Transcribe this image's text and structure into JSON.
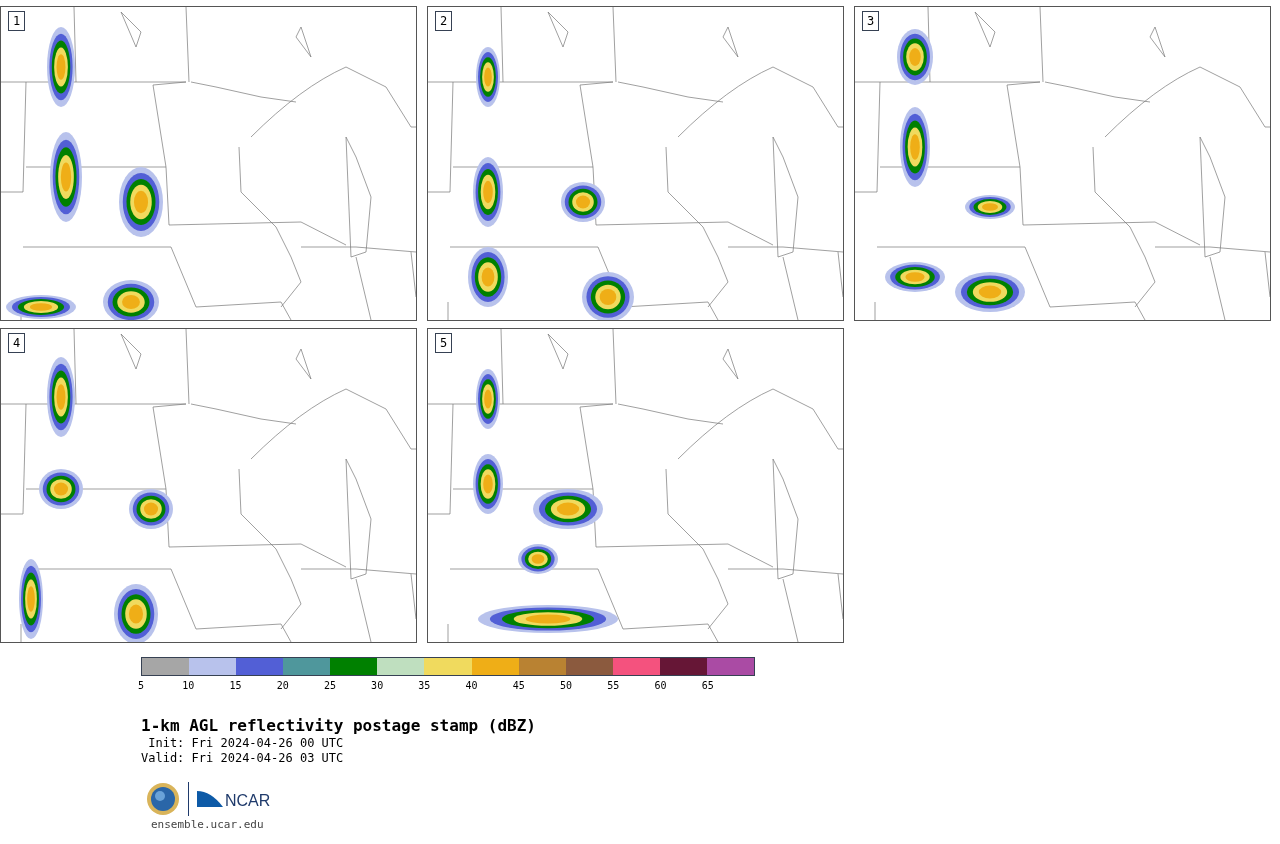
{
  "panels": [
    {
      "label": "1"
    },
    {
      "label": "2"
    },
    {
      "label": "3"
    },
    {
      "label": "4"
    },
    {
      "label": "5"
    }
  ],
  "colorbar": {
    "bins": [
      {
        "color": "#a6a6a6",
        "label": "5"
      },
      {
        "color": "#b8c2ec",
        "label": "10"
      },
      {
        "color": "#525fd6",
        "label": "15"
      },
      {
        "color": "#4f979c",
        "label": "20"
      },
      {
        "color": "#008000",
        "label": "25"
      },
      {
        "color": "#bfdfbf",
        "label": "30"
      },
      {
        "color": "#f0da5e",
        "label": "35"
      },
      {
        "color": "#efae17",
        "label": "40"
      },
      {
        "color": "#b98232",
        "label": "45"
      },
      {
        "color": "#8b5a3e",
        "label": "50"
      },
      {
        "color": "#f4527e",
        "label": "55"
      },
      {
        "color": "#661636",
        "label": "60"
      },
      {
        "color": "#aa4ba4",
        "label": "65"
      }
    ]
  },
  "title": "1-km AGL reflectivity postage stamp (dBZ)",
  "init": " Init: Fri 2024-04-26 00 UTC",
  "valid": "Valid: Fri 2024-04-26 03 UTC",
  "logo": {
    "text": "NCAR",
    "url": "ensemble.ucar.edu"
  }
}
